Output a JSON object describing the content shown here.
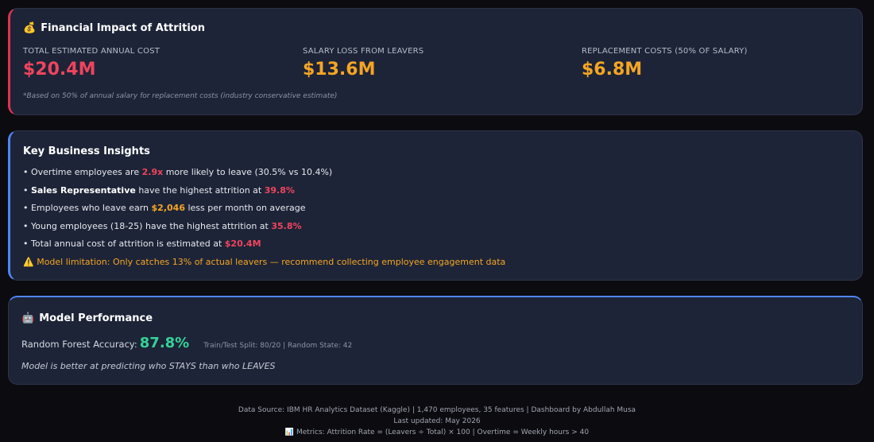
{
  "financial": {
    "icon": "money-bag-icon",
    "title": "Financial Impact of Attrition",
    "metrics": [
      {
        "label": "TOTAL ESTIMATED ANNUAL COST",
        "value": "$20.4M",
        "color": "#f0445e"
      },
      {
        "label": "SALARY LOSS FROM LEAVERS",
        "value": "$13.6M",
        "color": "#f5a524"
      },
      {
        "label": "REPLACEMENT COSTS (50% OF SALARY)",
        "value": "$6.8M",
        "color": "#f5a524"
      }
    ],
    "footnote": "*Based on 50% of annual salary for replacement costs (industry conservative estimate)"
  },
  "insights": {
    "title": "Key Business Insights",
    "items": [
      {
        "pre": "• Overtime employees are ",
        "hl": "2.9x",
        "post": " more likely to leave (30.5% vs 10.4%)"
      },
      {
        "pre": "• ",
        "strong": "Sales Representative",
        "mid": " have the highest attrition at ",
        "hl": "39.8%"
      },
      {
        "pre": "• Employees who leave earn ",
        "hl": "$2,046",
        "post": " less per month on average"
      },
      {
        "pre": "• Young employees (18-25) have the highest attrition at ",
        "hl": "35.8%"
      },
      {
        "pre": "• Total annual cost of attrition is estimated at ",
        "hl": "$20.4M"
      }
    ],
    "warning_icon": "warning-icon",
    "warning": "Model limitation: Only catches 13% of actual leavers — recommend collecting employee engagement data"
  },
  "model": {
    "icon": "robot-icon",
    "title": "Model Performance",
    "accuracy_label": "Random Forest Accuracy:",
    "accuracy_value": "87.8%",
    "meta": "Train/Test Split: 80/20 | Random State: 42",
    "note": "Model is better at predicting who STAYS than who LEAVES"
  },
  "footer": {
    "source": "Data Source: IBM HR Analytics Dataset (Kaggle) | 1,470 employees, 35 features | Dashboard by Abdullah Musa",
    "updated": "Last updated: May 2026",
    "metrics_icon": "bar-chart-icon",
    "metrics": "Metrics: Attrition Rate = (Leavers ÷ Total) × 100 | Overtime = Weekly hours > 40"
  },
  "colors": {
    "background": "#0c0b10",
    "card": "#1d2437",
    "accent_red": "#f0445e",
    "accent_orange": "#f5a524",
    "accent_green": "#34d399",
    "accent_blue": "#4f86f7"
  }
}
